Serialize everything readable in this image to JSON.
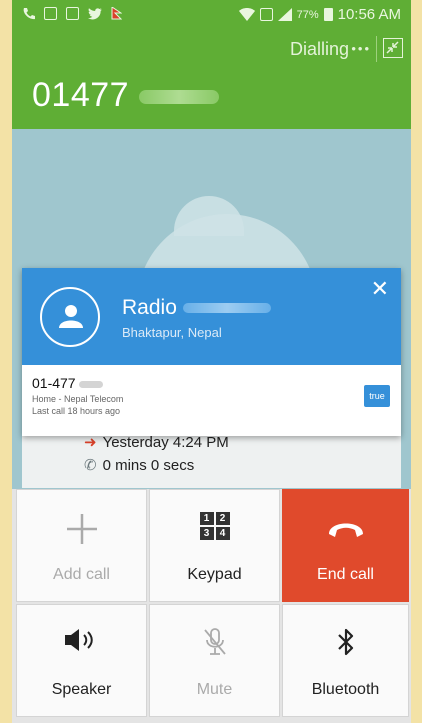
{
  "status_bar": {
    "battery": "77%",
    "time": "10:56 AM"
  },
  "header": {
    "call_status": "Dialling",
    "number": "01477"
  },
  "caller_card": {
    "name": "Radio",
    "location": "Bhaktapur, Nepal",
    "number": "01-477",
    "type_operator": "Home - Nepal Telecom",
    "last_call": "Last call 18 hours ago",
    "badge": "true"
  },
  "history": {
    "time": "Yesterday 4:24 PM",
    "duration": "0 mins 0 secs"
  },
  "actions": {
    "add_call": "Add call",
    "keypad": "Keypad",
    "end_call": "End call",
    "speaker": "Speaker",
    "mute": "Mute",
    "bluetooth": "Bluetooth"
  },
  "keypad_digits": [
    "1",
    "2",
    "3",
    "4"
  ],
  "colors": {
    "header_green": "#5fae35",
    "card_blue": "#3590d9",
    "end_call_red": "#e04a2c"
  },
  "icons": [
    "phone-icon",
    "gallery-icon",
    "message-icon",
    "twitter-icon",
    "flag-icon",
    "wifi-icon",
    "sim-icon",
    "signal-icon",
    "battery-icon",
    "shrink-icon",
    "person-icon",
    "close-icon",
    "outgoing-arrow-icon",
    "plus-icon",
    "keypad-icon",
    "hang-up-icon",
    "speaker-icon",
    "mic-muted-icon",
    "bluetooth-icon"
  ]
}
